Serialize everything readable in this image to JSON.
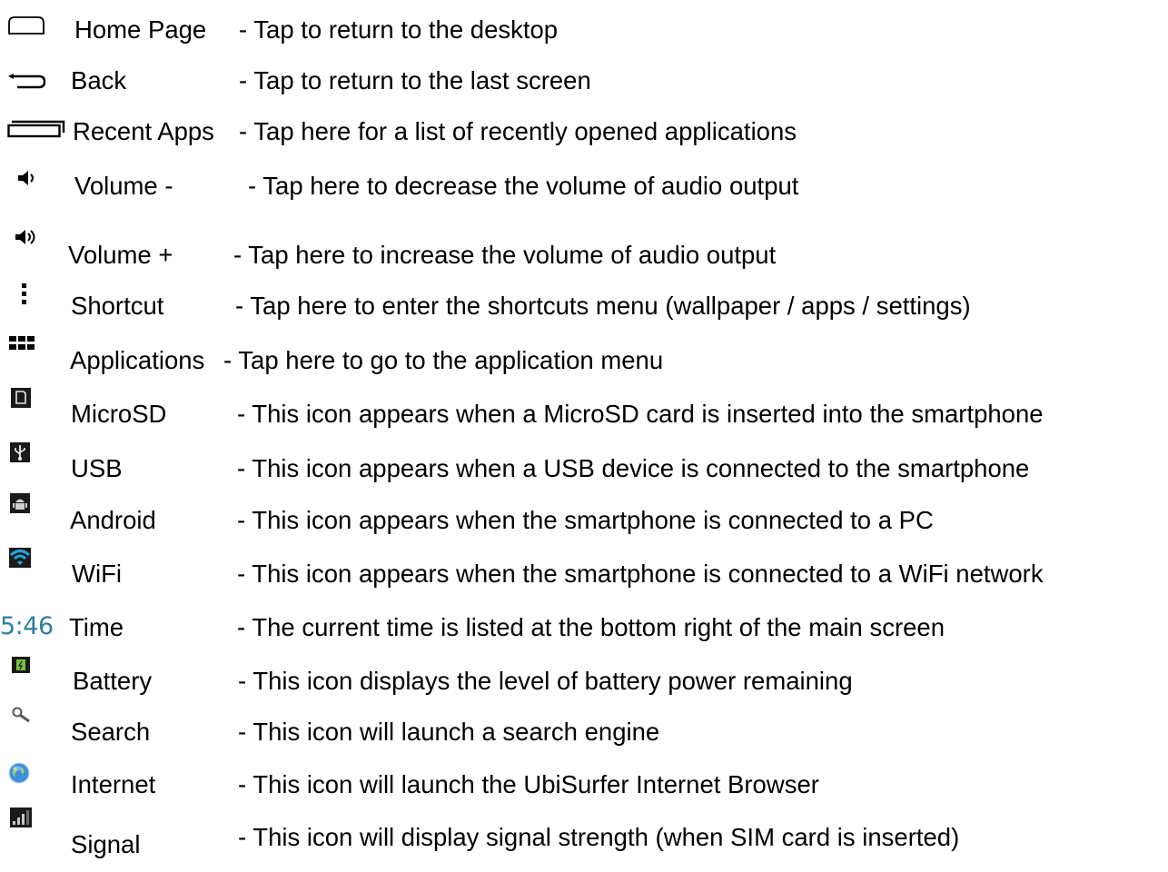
{
  "items": [
    {
      "icon": "home-outline-icon",
      "name": "Home Page",
      "description": "- Tap to return to the desktop"
    },
    {
      "icon": "back-arrow-icon",
      "name": "Back",
      "description": "- Tap to return to the last screen"
    },
    {
      "icon": "recent-apps-icon",
      "name": "Recent Apps",
      "description": "- Tap here for a list of recently opened applications"
    },
    {
      "icon": "volume-down-icon",
      "name": "Volume -",
      "description": "- Tap here to decrease the volume of audio output"
    },
    {
      "icon": "volume-up-icon",
      "name": "Volume +",
      "description": "- Tap here to increase the volume of audio output"
    },
    {
      "icon": "overflow-menu-icon",
      "name": "Shortcut",
      "description": "- Tap here to enter the shortcuts menu (wallpaper / apps / settings)"
    },
    {
      "icon": "app-grid-icon",
      "name": "Applications",
      "description": "- Tap here to go to the application menu"
    },
    {
      "icon": "sd-card-icon",
      "name": "MicroSD",
      "description": "- This icon appears when a MicroSD card is inserted into the smartphone"
    },
    {
      "icon": "usb-icon",
      "name": "USB",
      "description": "- This icon appears when a USB device is connected to the smartphone"
    },
    {
      "icon": "android-icon",
      "name": "Android",
      "description": "- This icon appears when the smartphone is connected to a PC"
    },
    {
      "icon": "wifi-icon",
      "name": "WiFi",
      "description": "- This icon appears when the smartphone is connected to a WiFi network"
    },
    {
      "icon": "clock-readout-icon",
      "icon_text": "5:46",
      "name": "Time",
      "description": "- The current time is listed at the bottom right of the main screen"
    },
    {
      "icon": "battery-icon",
      "name": "Battery",
      "description": "- This icon displays the level of battery power remaining"
    },
    {
      "icon": "search-icon",
      "name": "Search",
      "description": "- This icon will launch a search engine"
    },
    {
      "icon": "globe-icon",
      "name": "Internet",
      "description": "- This icon will launch the UbiSurfer Internet Browser"
    },
    {
      "icon": "signal-strength-icon",
      "name": "Signal",
      "description": "- This icon will display signal strength (when SIM card is inserted)"
    }
  ],
  "colors": {
    "text": "#000000",
    "time_icon": "#2f7fa0",
    "wifi_icon": "#1fa8d8",
    "battery_icon": "#7ac143",
    "globe_icon": "#3c8fd8"
  }
}
